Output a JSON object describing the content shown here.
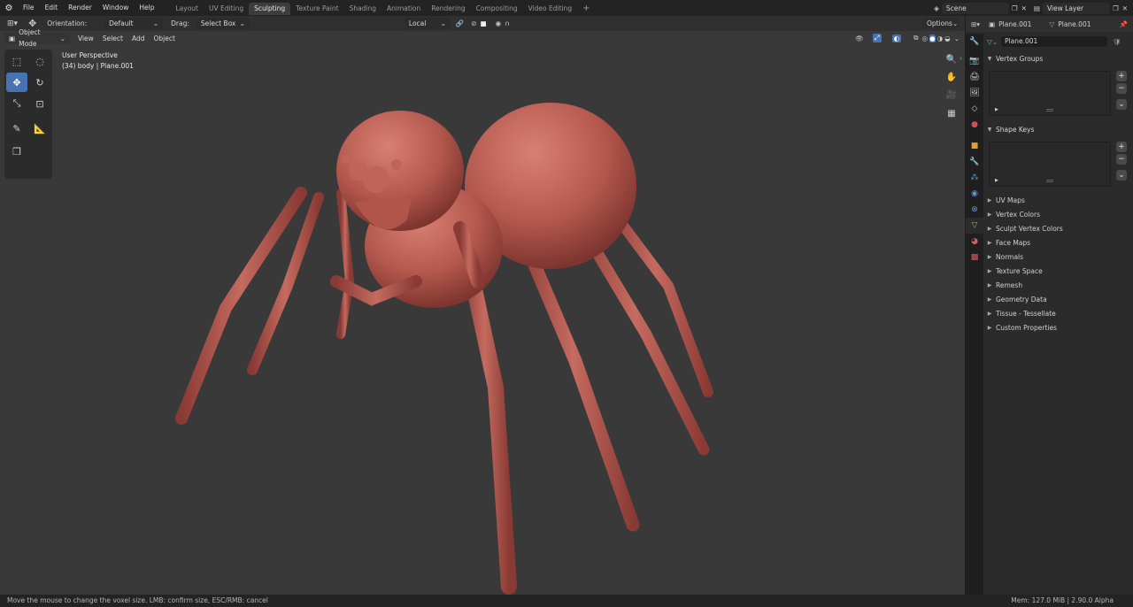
{
  "topbar": {
    "menus": [
      "File",
      "Edit",
      "Render",
      "Window",
      "Help"
    ],
    "workspaces": [
      "Layout",
      "UV Editing",
      "Sculpting",
      "Texture Paint",
      "Shading",
      "Animation",
      "Rendering",
      "Compositing",
      "Video Editing"
    ],
    "active_workspace": "Sculpting",
    "add_workspace": "+",
    "scene": "Scene",
    "view_layer": "View Layer"
  },
  "viewport": {
    "orientation_label": "Orientation:",
    "orientation_value": "Default",
    "drag_label": "Drag:",
    "drag_value": "Select Box",
    "pivot_value": "Local",
    "options": "Options",
    "mode": "Object Mode",
    "menu_view": "View",
    "menu_select": "Select",
    "menu_add": "Add",
    "menu_object": "Object",
    "perspective": "User Perspective",
    "object_info": "(34) body | Plane.001"
  },
  "props": {
    "header_object": "Plane.001",
    "header_mesh": "Plane.001",
    "mesh_name": "Plane.001",
    "vertex_groups": "Vertex Groups",
    "shape_keys": "Shape Keys",
    "subpanels": [
      "UV Maps",
      "Vertex Colors",
      "Sculpt Vertex Colors",
      "Face Maps",
      "Normals",
      "Texture Space",
      "Remesh",
      "Geometry Data",
      "Tissue - Tessellate",
      "Custom Properties"
    ],
    "plus": "+",
    "minus": "−"
  },
  "status": {
    "hint": "Move the mouse to change the voxel size. LMB: confirm size, ESC/RMB: cancel",
    "mem": "Mem: 127.0 MiB | 2.90.0 Alpha"
  },
  "colors": {
    "accent": "#4772b3",
    "mesh": "#b5584e",
    "viewport_bg": "#393939"
  }
}
